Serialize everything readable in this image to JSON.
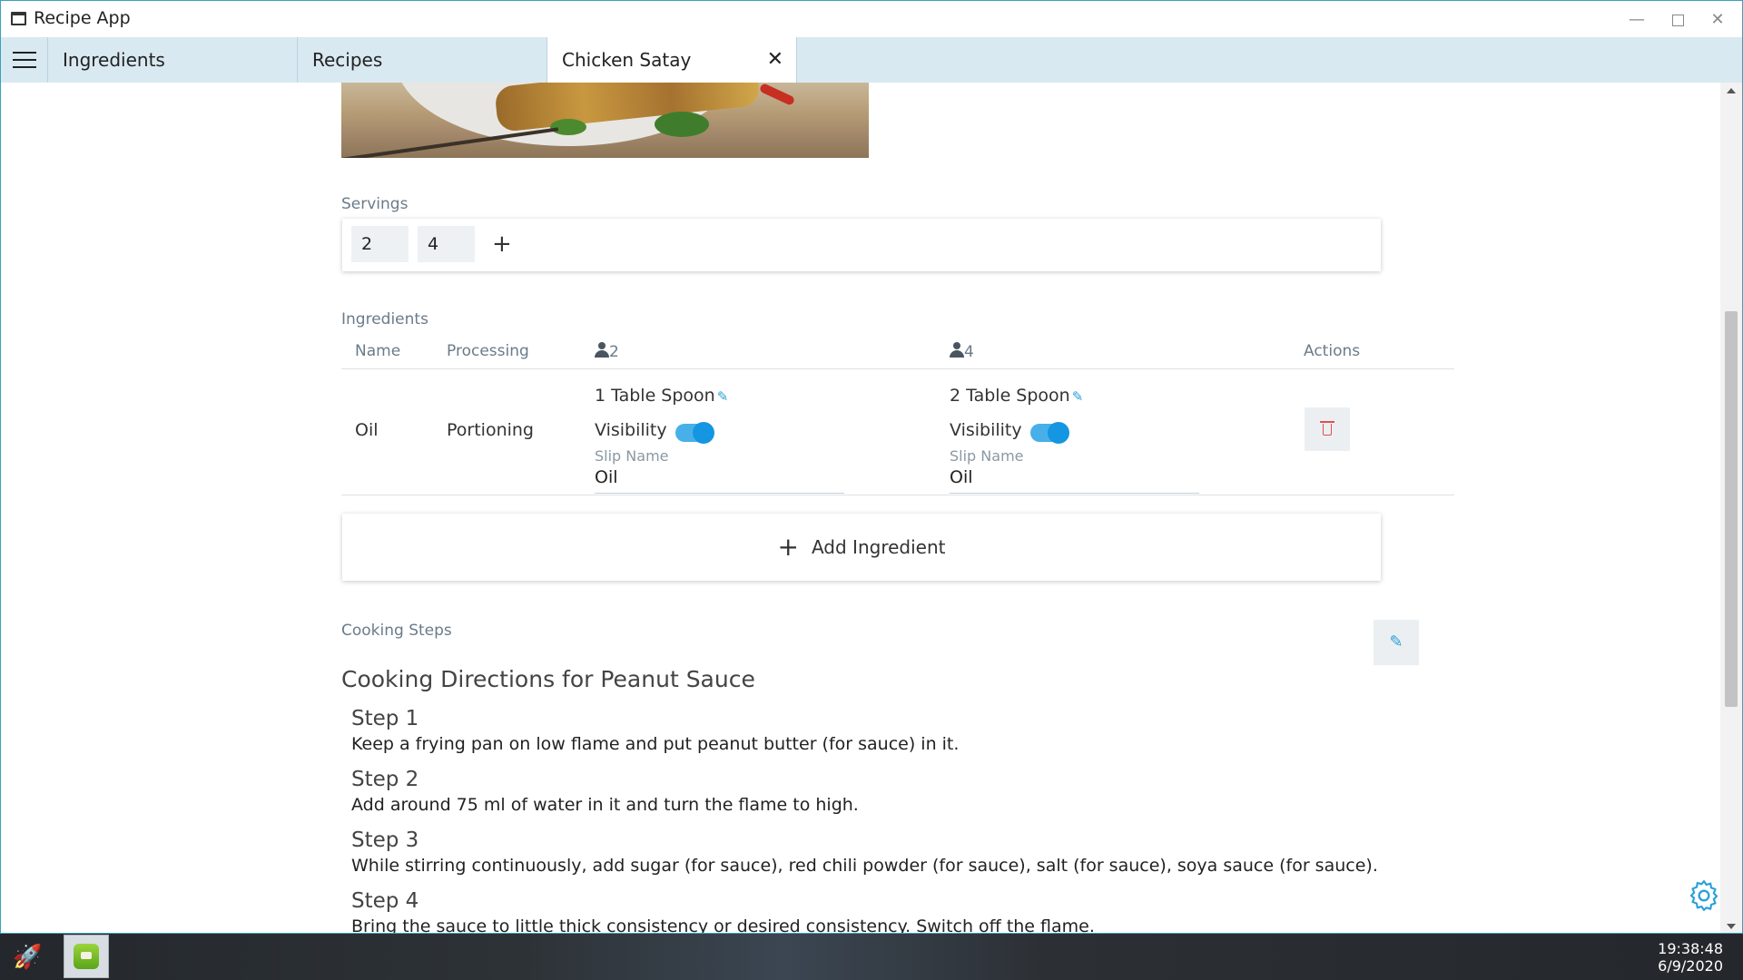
{
  "window": {
    "title": "Recipe App"
  },
  "tabs": [
    {
      "label": "Ingredients"
    },
    {
      "label": "Recipes"
    },
    {
      "label": "Chicken Satay",
      "active": true
    }
  ],
  "servings": {
    "label": "Servings",
    "values": [
      "2",
      "4"
    ],
    "add_label": "+"
  },
  "ingredients": {
    "label": "Ingredients",
    "headers": {
      "name": "Name",
      "processing": "Processing",
      "serving_a": "2",
      "serving_b": "4",
      "actions": "Actions"
    },
    "rows": [
      {
        "name": "Oil",
        "processing": "Portioning",
        "serving_a": {
          "quantity": "1 Table Spoon",
          "visibility_label": "Visibility",
          "visible": true,
          "slip_name_label": "Slip Name",
          "slip_name": "Oil"
        },
        "serving_b": {
          "quantity": "2 Table Spoon",
          "visibility_label": "Visibility",
          "visible": true,
          "slip_name_label": "Slip Name",
          "slip_name": "Oil"
        }
      }
    ],
    "add_label": "Add Ingredient"
  },
  "cooking": {
    "label": "Cooking Steps",
    "title": "Cooking Directions for Peanut Sauce",
    "steps": [
      {
        "title": "Step 1",
        "text": "Keep a frying pan on low flame and put peanut butter (for sauce) in it."
      },
      {
        "title": "Step 2",
        "text": "Add around 75 ml of water in it and turn the flame to high."
      },
      {
        "title": "Step 3",
        "text": "While stirring continuously, add sugar (for sauce), red chili powder (for sauce), salt (for sauce), soya sauce (for sauce)."
      },
      {
        "title": "Step 4",
        "text": "Bring the sauce to little thick consistency or desired consistency. Switch off the flame."
      }
    ]
  },
  "taskbar": {
    "time": "19:38:48",
    "date": "6/9/2020"
  },
  "colors": {
    "accent": "#1496e2",
    "tabbar": "#d9e9f1",
    "danger": "#e05050"
  },
  "icons": [
    "window-icon",
    "minimize-icon",
    "maximize-icon",
    "close-icon",
    "hamburger-icon",
    "person-icon",
    "pencil-icon",
    "trash-icon",
    "plus-icon",
    "gear-icon",
    "rocket-icon"
  ]
}
